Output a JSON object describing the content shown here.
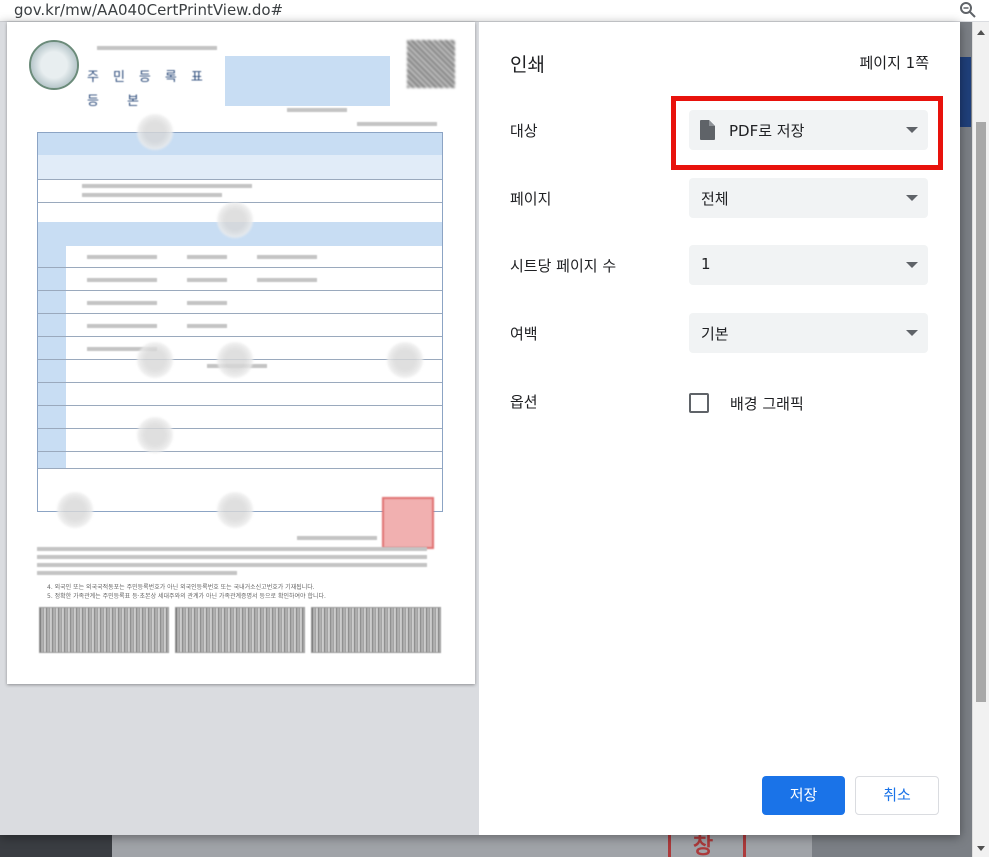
{
  "browser": {
    "url": "gov.kr/mw/AA040CertPrintView.do#",
    "zoom_icon": "zoom-icon"
  },
  "backdrop": {
    "stamp_text": "창 인"
  },
  "dialog": {
    "title": "인쇄",
    "page_count": "페이지 1쪽",
    "destination": {
      "label": "대상",
      "value": "PDF로 저장",
      "icon": "file-icon"
    },
    "pages": {
      "label": "페이지",
      "value": "전체"
    },
    "pages_per_sheet": {
      "label": "시트당 페이지 수",
      "value": "1"
    },
    "margins": {
      "label": "여백",
      "value": "기본"
    },
    "options": {
      "label": "옵션",
      "background_graphics": "배경 그래픽",
      "background_graphics_checked": false
    },
    "save_button": "저장",
    "cancel_button": "취소",
    "highlight_color": "#e8120c",
    "accent_color": "#1a73e8"
  },
  "preview": {
    "notes": [
      "4. 외국인 또는 외국국적동포는 주민등록번호가 아닌 외국인등록번호 또는 국내거소신고번호가 기재됩니다.",
      "5. 정확한 가족관계는 주민등록표 등·초본상 세대주와의 관계가 아닌 가족관계증명서 등으로 확인하여야 합니다."
    ]
  }
}
